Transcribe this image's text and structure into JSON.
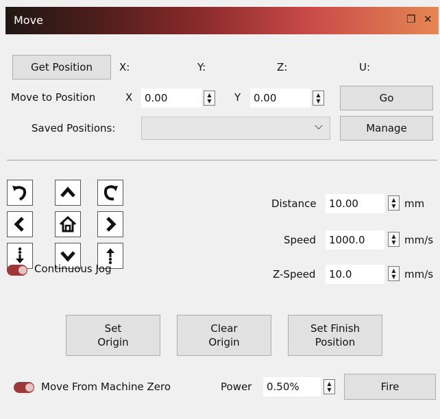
{
  "title": "Move",
  "title_icons": [
    "restore-icon",
    "close-icon"
  ],
  "position_row": {
    "get_position_button": "Get Position",
    "x_label": "X:",
    "y_label": "Y:",
    "z_label": "Z:",
    "u_label": "U:"
  },
  "move_to": {
    "label": "Move to Position",
    "x_label": "X",
    "x_value": "0.00",
    "y_label": "Y",
    "y_value": "0.00",
    "go_button": "Go"
  },
  "saved": {
    "label": "Saved Positions:",
    "value": "",
    "manage_button": "Manage"
  },
  "jog_buttons": [
    "rotate-ccw-icon",
    "arrow-up-icon",
    "rotate-cw-icon",
    "arrow-left-icon",
    "home-icon",
    "arrow-right-icon",
    "z-down-icon",
    "arrow-down-icon",
    "z-up-icon"
  ],
  "continuous_jog": {
    "label": "Continuous Jog",
    "on": true
  },
  "distance": {
    "label": "Distance",
    "value": "10.00",
    "unit": "mm"
  },
  "speed": {
    "label": "Speed",
    "value": "1000.0",
    "unit": "mm/s"
  },
  "zspeed": {
    "label": "Z-Speed",
    "value": "10.0",
    "unit": "mm/s"
  },
  "origin_buttons": {
    "set_origin_line1": "Set",
    "set_origin_line2": "Origin",
    "clear_origin_line1": "Clear",
    "clear_origin_line2": "Origin",
    "set_finish_line1": "Set Finish",
    "set_finish_line2": "Position"
  },
  "machine_zero": {
    "label": "Move From Machine Zero",
    "on": true
  },
  "power": {
    "label": "Power",
    "value": "0.50%"
  },
  "fire_button": "Fire",
  "colors": {
    "title_gradient_start": "#1f1714",
    "title_gradient_end": "#e58753",
    "toggle": "#9b3838"
  }
}
